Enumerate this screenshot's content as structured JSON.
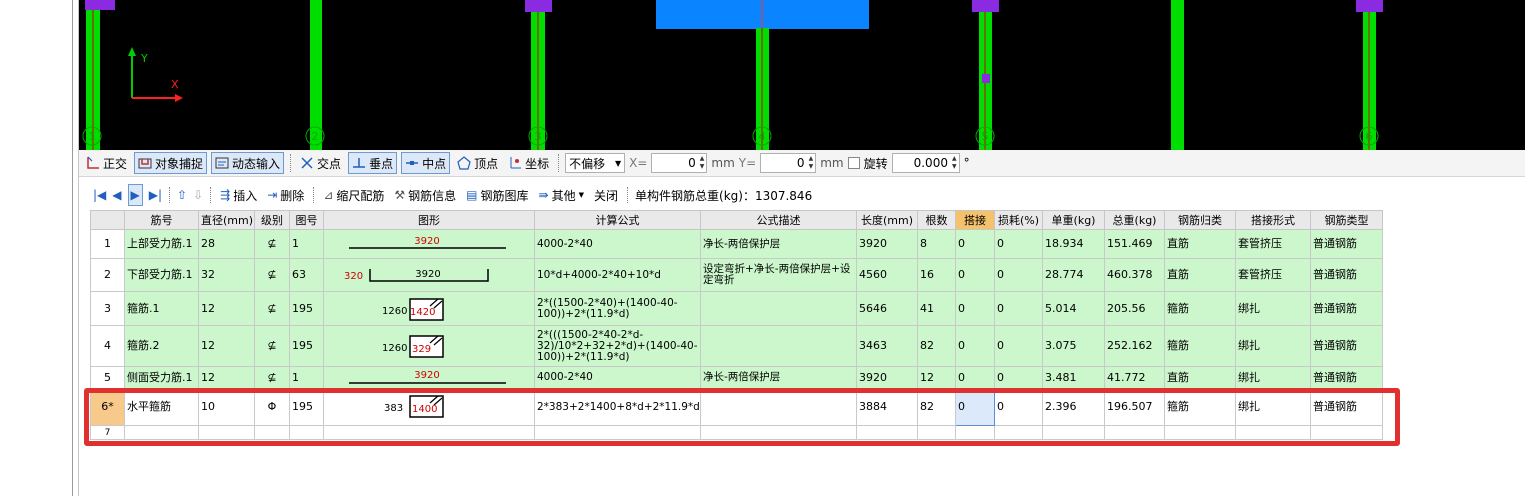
{
  "snap_toolbar": {
    "ortho": "正交",
    "object_snap": "对象捕捉",
    "dynamic_input": "动态输入",
    "intersection": "交点",
    "perpendicular": "垂点",
    "midpoint": "中点",
    "vertex": "顶点",
    "coordinate": "坐标",
    "offset_select": "不偏移",
    "x_label": "X=",
    "x_value": "0",
    "x_unit": "mm",
    "y_label": "Y=",
    "y_value": "0",
    "y_unit": "mm",
    "rotate": "旋转",
    "rotate_value": "0.000",
    "degree": "°"
  },
  "cad": {
    "axis_y": "Y",
    "axis_x": "X",
    "grid_labels": [
      "1",
      "2",
      "3",
      "4",
      "5",
      "6"
    ]
  },
  "rebar_toolbar": {
    "insert": "插入",
    "delete": "删除",
    "scale_rebar": "缩尺配筋",
    "rebar_info": "钢筋信息",
    "rebar_library": "钢筋图库",
    "other": "其他",
    "close": "关闭",
    "total_weight": "单构件钢筋总重(kg)：1307.846"
  },
  "table": {
    "headers": [
      "",
      "筋号",
      "直径(mm)",
      "级别",
      "图号",
      "图形",
      "计算公式",
      "公式描述",
      "长度(mm)",
      "根数",
      "搭接",
      "损耗(%)",
      "单重(kg)",
      "总重(kg)",
      "钢筋归类",
      "搭接形式",
      "钢筋类型"
    ],
    "rows": [
      {
        "num": "1",
        "name": "上部受力筋.1",
        "dia": "28",
        "grade": "⊈",
        "fig": "1",
        "shape_text": "3920",
        "shape_left": "",
        "formula": "4000-2*40",
        "desc": "净长-两倍保护层",
        "length": "3920",
        "count": "8",
        "lap": "0",
        "loss": "0",
        "unit_w": "18.934",
        "total_w": "151.469",
        "category": "直筋",
        "lap_form": "套管挤压",
        "type": "普通钢筋"
      },
      {
        "num": "2",
        "name": "下部受力筋.1",
        "dia": "32",
        "grade": "⊈",
        "fig": "63",
        "shape_text": "3920",
        "shape_left": "320",
        "formula": "10*d+4000-2*40+10*d",
        "desc": "设定弯折+净长-两倍保护层+设定弯折",
        "length": "4560",
        "count": "16",
        "lap": "0",
        "loss": "0",
        "unit_w": "28.774",
        "total_w": "460.378",
        "category": "直筋",
        "lap_form": "套管挤压",
        "type": "普通钢筋"
      },
      {
        "num": "3",
        "name": "箍筋.1",
        "dia": "12",
        "grade": "⊈",
        "fig": "195",
        "shape_text": "1420",
        "shape_left": "1260",
        "formula": "2*((1500-2*40)+(1400-40-100))+2*(11.9*d)",
        "desc": "",
        "length": "5646",
        "count": "41",
        "lap": "0",
        "loss": "0",
        "unit_w": "5.014",
        "total_w": "205.56",
        "category": "箍筋",
        "lap_form": "绑扎",
        "type": "普通钢筋"
      },
      {
        "num": "4",
        "name": "箍筋.2",
        "dia": "12",
        "grade": "⊈",
        "fig": "195",
        "shape_text": "329",
        "shape_left": "1260",
        "formula": "2*(((1500-2*40-2*d-32)/10*2+32+2*d)+(1400-40-100))+2*(11.9*d)",
        "desc": "",
        "length": "3463",
        "count": "82",
        "lap": "0",
        "loss": "0",
        "unit_w": "3.075",
        "total_w": "252.162",
        "category": "箍筋",
        "lap_form": "绑扎",
        "type": "普通钢筋"
      },
      {
        "num": "5",
        "name": "侧面受力筋.1",
        "dia": "12",
        "grade": "⊈",
        "fig": "1",
        "shape_text": "3920",
        "shape_left": "",
        "formula": "4000-2*40",
        "desc": "净长-两倍保护层",
        "length": "3920",
        "count": "12",
        "lap": "0",
        "loss": "0",
        "unit_w": "3.481",
        "total_w": "41.772",
        "category": "直筋",
        "lap_form": "绑扎",
        "type": "普通钢筋"
      },
      {
        "num": "6*",
        "name": "水平箍筋",
        "dia": "10",
        "grade": "Φ",
        "fig": "195",
        "shape_text": "1400",
        "shape_left": "383",
        "formula": "2*383+2*1400+8*d+2*11.9*d",
        "desc": "",
        "length": "3884",
        "count": "82",
        "lap": "0",
        "loss": "0",
        "unit_w": "2.396",
        "total_w": "196.507",
        "category": "箍筋",
        "lap_form": "绑扎",
        "type": "普通钢筋"
      },
      {
        "num": "7",
        "name": "",
        "dia": "",
        "grade": "",
        "fig": "",
        "shape_text": "",
        "shape_left": "",
        "formula": "",
        "desc": "",
        "length": "",
        "count": "",
        "lap": "",
        "loss": "",
        "unit_w": "",
        "total_w": "",
        "category": "",
        "lap_form": "",
        "type": ""
      }
    ]
  },
  "colors": {
    "cad_background": "#000000",
    "column_green": "#00dd00",
    "beam_blue": "#0a84ff",
    "marker_purple": "#8a2be2",
    "row_green": "#ccf7cc",
    "highlight_red": "#e03030",
    "lap_header": "#f5c26b"
  }
}
